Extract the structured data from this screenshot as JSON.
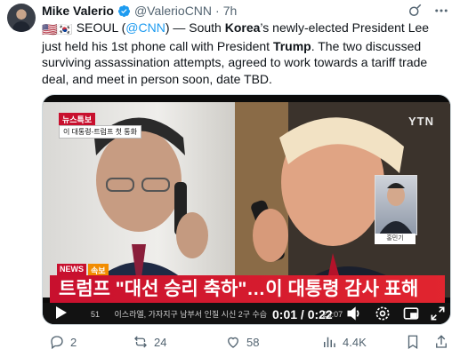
{
  "author": {
    "name": "Mike Valerio",
    "handle": "@ValerioCNN",
    "separator": "·",
    "time": "7h"
  },
  "tweet": {
    "flags_prefix": "🇺🇸🇰🇷",
    "part1": " SEOUL (",
    "mention": "@CNN",
    "part2": ") — South ",
    "bold1": "Korea",
    "part3": "’s newly-elected President Lee just held his 1st phone call with President ",
    "bold2": "Trump",
    "part4": ". The two discussed surviving assassination attempts, agreed to work towards a tariff trade deal, and meet in person soon, date TBD."
  },
  "video": {
    "news_tag": "뉴스특보",
    "news_sub": "이 대통령-트럼프 첫 통화",
    "channel_logo": "YTN",
    "pip_label": "홍민기",
    "news_badge_1": "NEWS",
    "news_badge_2": "속보",
    "headline": "트럼프 \"대선 승리 축하\"…이 대통령 감사 표해",
    "ticker": "이스라엘, 가자지구 남부서 인질 시신 2구 수습",
    "ticker_prefix": "51",
    "ticker_suffix": "23:07",
    "time": "0:01 / 0:22"
  },
  "actions": {
    "replies": "2",
    "reposts": "24",
    "likes": "58",
    "views": "4.4K"
  },
  "colors": {
    "verified": "#1d9bf0",
    "link": "#1d9bf0",
    "news_red": "#c8102e"
  }
}
